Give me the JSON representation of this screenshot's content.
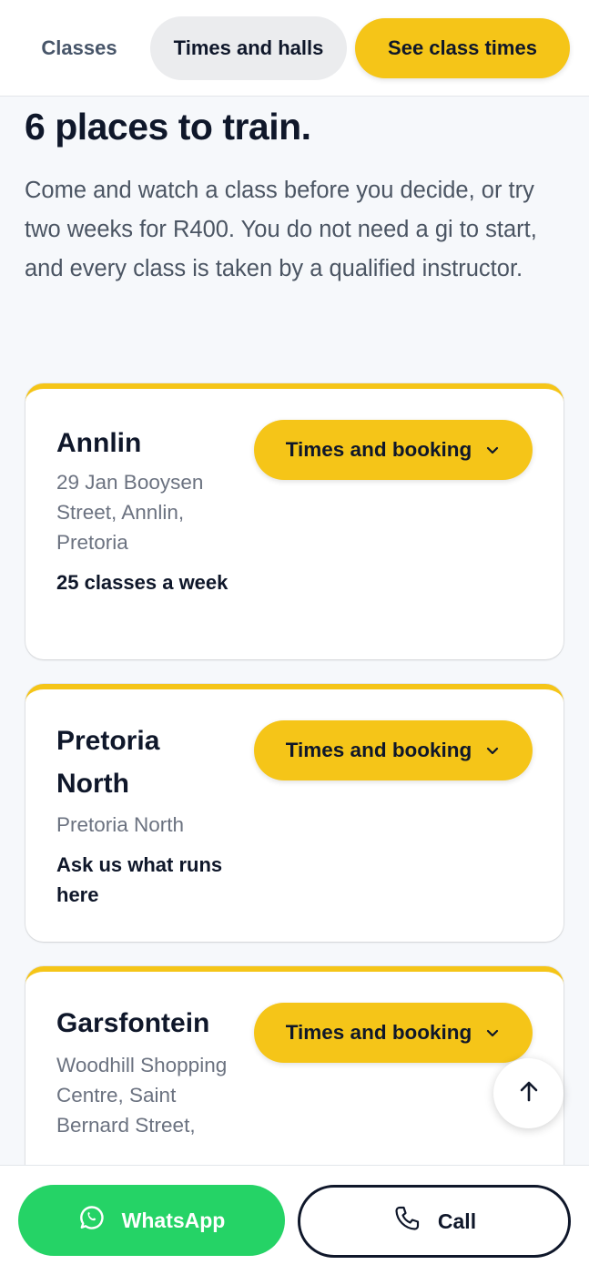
{
  "nav": {
    "classes": "Classes",
    "times_and_halls": "Times and halls",
    "cta": "See class times"
  },
  "hero": {
    "headline": "6 places to train.",
    "intro": "Come and watch a class before you decide, or try two weeks for R400. You do not need a gi to start, and every class is taken by a qualified instructor."
  },
  "locations": [
    {
      "name": "Annlin",
      "address": "29 Jan Booysen Street, Annlin, Pretoria",
      "classes": "25 classes a week",
      "button": "Times and booking"
    },
    {
      "name": "Pretoria North",
      "address": "Pretoria North",
      "classes": "Ask us what runs here",
      "button": "Times and booking"
    },
    {
      "name": "Garsfontein",
      "address": "Woodhill Shopping Centre, Saint Bernard Street,",
      "button": "Times and booking"
    }
  ],
  "bottom_bar": {
    "whatsapp": "WhatsApp",
    "call": "Call"
  },
  "colors": {
    "accent": "#f5c518",
    "whatsapp": "#25d366",
    "text": "#0f172a",
    "muted": "#6b7280"
  },
  "icons": {
    "chevron": "chevron-down-icon",
    "scroll_top": "arrow-up-icon",
    "whatsapp": "whatsapp-icon",
    "call": "phone-icon"
  }
}
